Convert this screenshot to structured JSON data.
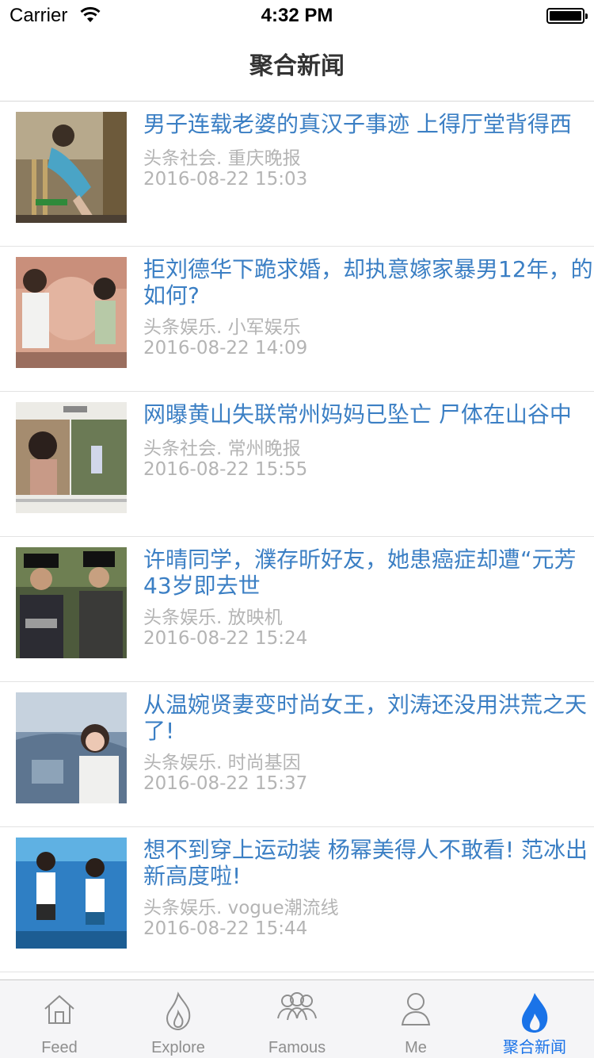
{
  "status_bar": {
    "carrier": "Carrier",
    "time": "4:32 PM"
  },
  "nav": {
    "title": "聚合新闻"
  },
  "news": [
    {
      "title": "男子连载老婆的真汉子事迹 上得厅堂背得西",
      "source": "头条社会. 重庆晚报",
      "date": "2016-08-22 15:03",
      "thumb": "woman-climbing-bamboo-ladder"
    },
    {
      "title": "拒刘德华下跪求婚，却执意嫁家暴男12年，的如何?",
      "source": "头条娱乐. 小军娱乐",
      "date": "2016-08-22 14:09",
      "thumb": "couple-on-stage-photo"
    },
    {
      "title": "网曝黄山失联常州妈妈已坠亡 尸体在山谷中",
      "source": "头条社会. 常州晚报",
      "date": "2016-08-22 15:55",
      "thumb": "missing-person-notice"
    },
    {
      "title": "许晴同学，濮存昕好友，她患癌症却遭“元芳43岁即去世",
      "source": "头条娱乐. 放映机",
      "date": "2016-08-22 15:24",
      "thumb": "period-drama-still"
    },
    {
      "title": "从温婉贤妻变时尚女王，刘涛还没用洪荒之天了!",
      "source": "头条娱乐. 时尚基因",
      "date": "2016-08-22 15:37",
      "thumb": "woman-in-car"
    },
    {
      "title": "想不到穿上运动装 杨幂美得人不敢看! 范冰出新高度啦!",
      "source": "头条娱乐. vogue潮流线",
      "date": "2016-08-22 15:44",
      "thumb": "tennis-outfit-women"
    }
  ],
  "tabs": [
    {
      "label": "Feed",
      "icon": "home-icon"
    },
    {
      "label": "Explore",
      "icon": "flame-outline-icon"
    },
    {
      "label": "Famous",
      "icon": "group-icon"
    },
    {
      "label": "Me",
      "icon": "person-icon"
    },
    {
      "label": "聚合新闻",
      "icon": "flame-filled-icon",
      "active": true
    }
  ],
  "colors": {
    "accent": "#1a73e8",
    "title_blue": "#3b7fc4",
    "meta_gray": "#b4b4b4",
    "tab_gray": "#8e8e8e"
  }
}
